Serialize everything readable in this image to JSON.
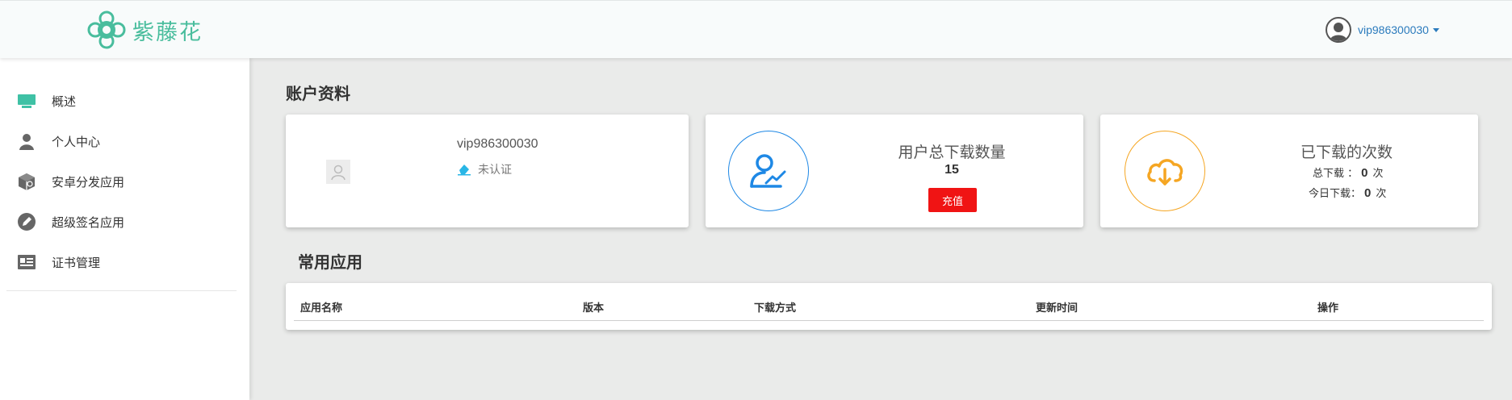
{
  "header": {
    "brand_name": "紫藤花",
    "user_name": "vip986300030",
    "brand_color": "#49bd9d",
    "link_color": "#2b7bbd"
  },
  "sidebar": {
    "items": [
      {
        "label": "概述",
        "icon": "monitor-icon"
      },
      {
        "label": "个人中心",
        "icon": "user-icon"
      },
      {
        "label": "安卓分发应用",
        "icon": "package-box-icon"
      },
      {
        "label": "超级签名应用",
        "icon": "pencil-circle-icon"
      },
      {
        "label": "证书管理",
        "icon": "id-card-icon"
      }
    ]
  },
  "account": {
    "section_title": "账户资料",
    "profile": {
      "name": "vip986300030",
      "status": "未认证"
    },
    "total_downloads": {
      "title": "用户总下载数量",
      "value": "15",
      "button_label": "充值"
    },
    "downloaded": {
      "title": "已下载的次数",
      "total_label": "总下载 ：",
      "total_value": "0",
      "today_label": "今日下载：",
      "today_value": "0",
      "unit": "次"
    }
  },
  "apps": {
    "section_title": "常用应用",
    "columns": [
      "应用名称",
      "版本",
      "下载方式",
      "更新时间",
      "操作"
    ]
  },
  "colors": {
    "accent_blue": "#1e88e5",
    "accent_orange": "#f5a623",
    "danger_red": "#f01414",
    "monitor_green": "#3fc1a5"
  }
}
